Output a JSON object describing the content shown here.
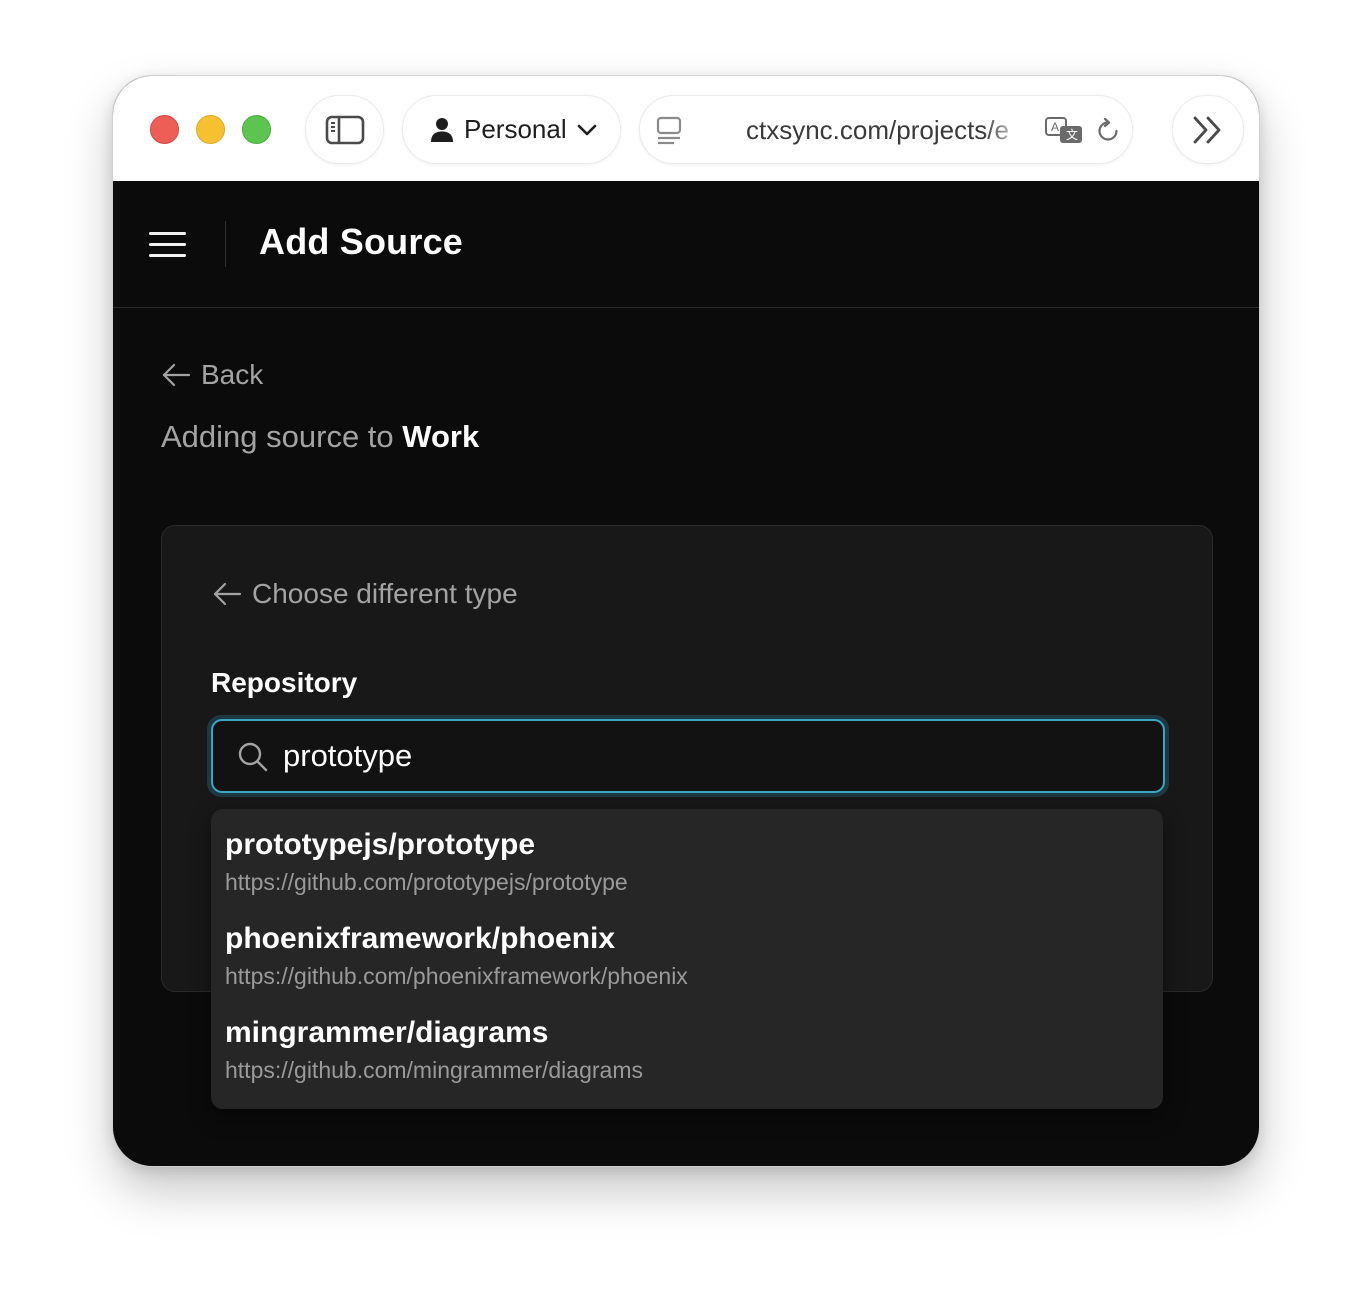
{
  "browser": {
    "profile_label": "Personal",
    "url": "ctxsync.com/projects/e",
    "icons": {
      "sidebar": "sidebar-icon",
      "profile": "person-icon",
      "profile_chevron": "chevron-down-icon",
      "reader": "reader-mode-icon",
      "translate": "translate-icon",
      "reload": "reload-icon",
      "more": "double-chevron-right-icon"
    }
  },
  "header": {
    "title": "Add Source",
    "menu_icon": "hamburger-menu-icon"
  },
  "content": {
    "back_label": "Back",
    "subtitle_prefix": "Adding source to",
    "project_name": "Work",
    "choose_type_label": "Choose different type",
    "field_label": "Repository",
    "search_value": "prototype",
    "search_icon": "search-icon",
    "results": [
      {
        "name": "prototypejs/prototype",
        "url": "https://github.com/prototypejs/prototype"
      },
      {
        "name": "phoenixframework/phoenix",
        "url": "https://github.com/phoenixframework/phoenix"
      },
      {
        "name": "mingrammer/diagrams",
        "url": "https://github.com/mingrammer/diagrams"
      }
    ]
  },
  "colors": {
    "traffic_red": "#ee5d56",
    "traffic_yellow": "#f6c131",
    "traffic_green": "#5dc44f",
    "app_background": "#0b0b0b",
    "card_background": "#181818",
    "dropdown_background": "#262626",
    "focus_ring": "#3aa6c3",
    "muted_text": "#a3a3a3"
  }
}
